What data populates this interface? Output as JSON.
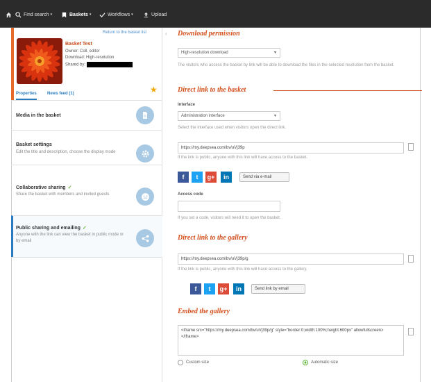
{
  "nav": {
    "search_label": "Find search",
    "baskets_label": "Baskets",
    "workflow_label": "Workflows",
    "upload_label": "Upload"
  },
  "basket": {
    "link_all": "Return to the basket list",
    "title": "Basket Test",
    "owner": "Owner: Coll. editor",
    "downloads": "Download: High-resolution",
    "shared": "Shared by:",
    "tab_properties": "Properties",
    "tab_news": "News feed (1)"
  },
  "menu": [
    {
      "title": "Media in the basket",
      "desc": "",
      "icon": "document-icon"
    },
    {
      "title": "Basket settings",
      "desc": "Edit the title and description, choose the display mode",
      "icon": "gear-icon"
    },
    {
      "title": "Collaborative sharing",
      "desc": "Share the basket with members and invited guests",
      "icon": "people-icon",
      "checked": true
    },
    {
      "title": "Public sharing and emailing",
      "desc": "Anyone with the link can view the basket in public mode or by email",
      "icon": "share-icon",
      "checked": true
    }
  ],
  "download": {
    "heading": "Download permission",
    "select_value": "High-resolution download",
    "help": "The visitors who access the basket by link will be able to download the files in the selected resolution from the basket."
  },
  "basket_link": {
    "heading": "Direct link to the basket",
    "interface_label": "Interface",
    "interface_value": "Administration interface",
    "interface_help": "Select the interface used when visitors open the direct link.",
    "url": "https://my.deepsea.com/bv/uVj39p",
    "url_help": "If the link is public, anyone with this link will have access to the basket.",
    "send_button": "Send via e-mail",
    "access_code_label": "Access code",
    "access_code_value": "",
    "access_code_help": "If you set a code, visitors will need it to open the basket."
  },
  "gallery_link": {
    "heading": "Direct link to the gallery",
    "url": "https://my.deepsea.com/bv/uVj39p/g",
    "url_help": "If the link is public, anyone with this link will have access to the gallery.",
    "send_button": "Send link by email"
  },
  "embed": {
    "heading": "Embed the gallery",
    "code": "<iframe src=\"https://my.deepsea.com/bv/uVj39p/g\" style=\"border:0;width:100%;height:600px\" allowfullscreen></iframe>",
    "radio_left": "Custom size",
    "radio_right": "Automatic size"
  },
  "colors": {
    "accent": "#d4501d",
    "link": "#2a7bbd",
    "check": "#64b43a"
  }
}
